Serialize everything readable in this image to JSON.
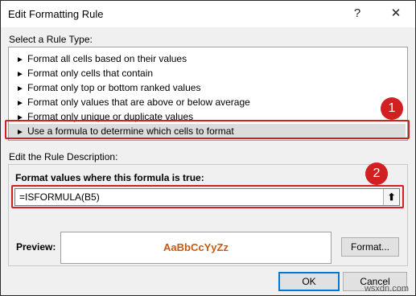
{
  "window": {
    "title": "Edit Formatting Rule",
    "help_glyph": "?",
    "close_glyph": "✕"
  },
  "rule_type": {
    "label": "Select a Rule Type:",
    "items": [
      {
        "arrow": "►",
        "label": "Format all cells based on their values"
      },
      {
        "arrow": "►",
        "label": "Format only cells that contain"
      },
      {
        "arrow": "►",
        "label": "Format only top or bottom ranked values"
      },
      {
        "arrow": "►",
        "label": "Format only values that are above or below average"
      },
      {
        "arrow": "►",
        "label": "Format only unique or duplicate values"
      },
      {
        "arrow": "►",
        "label": "Use a formula to determine which cells to format"
      }
    ],
    "selected_index": 5
  },
  "description": {
    "label": "Edit the Rule Description:",
    "formula_label": "Format values where this formula is true:",
    "formula_value": "=ISFORMULA(B5)",
    "collapse_glyph": "⬆"
  },
  "preview": {
    "label": "Preview:",
    "sample_text": "AaBbCcYyZz",
    "sample_color": "#c55a11"
  },
  "buttons": {
    "format": "Format...",
    "ok": "OK",
    "cancel": "Cancel"
  },
  "annotations": {
    "badge_1": "1",
    "badge_2": "2",
    "color": "#d21f1f"
  },
  "watermark": "wsxdn.com"
}
